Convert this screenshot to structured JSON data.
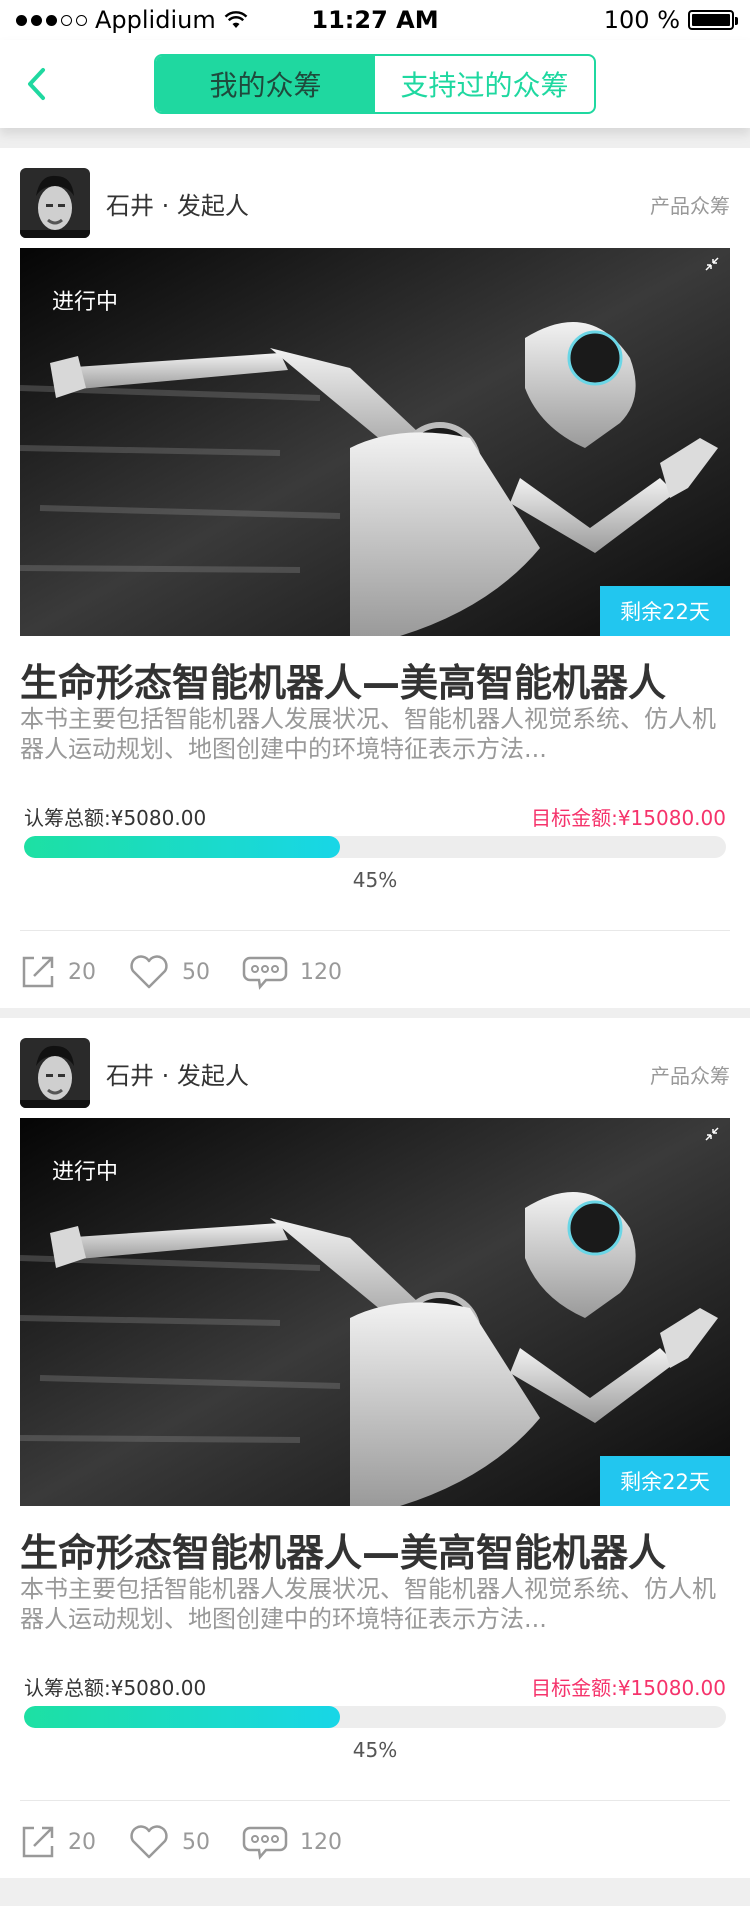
{
  "status_bar": {
    "carrier": "Applidium",
    "time": "11:27 AM",
    "battery": "100 %",
    "signal_bars_filled": 3,
    "signal_bars_total": 5
  },
  "nav": {
    "back_icon": "chevron-left-icon",
    "tabs": [
      {
        "label": "我的众筹",
        "active": true
      },
      {
        "label": "支持过的众筹",
        "active": false
      }
    ]
  },
  "projects": [
    {
      "author": "石井 · 发起人",
      "category": "产品众筹",
      "status": "进行中",
      "remaining": "剩余22天",
      "title": "生命形态智能机器人—美高智能机器人",
      "description": "本书主要包括智能机器人发展状况、智能机器人视觉系统、仿人机器人运动规划、地图创建中的环境特征表示方法...",
      "raised": "认筹总额:¥5080.00",
      "target": "目标金额:¥15080.00",
      "progress_percent": 45,
      "progress_label": "45%",
      "shares": "20",
      "likes": "50",
      "comments": "120"
    },
    {
      "author": "石井 · 发起人",
      "category": "产品众筹",
      "status": "进行中",
      "remaining": "剩余22天",
      "title": "生命形态智能机器人—美高智能机器人",
      "description": "本书主要包括智能机器人发展状况、智能机器人视觉系统、仿人机器人运动规划、地图创建中的环境特征表示方法...",
      "raised": "认筹总额:¥5080.00",
      "target": "目标金额:¥15080.00",
      "progress_percent": 45,
      "progress_label": "45%",
      "shares": "20",
      "likes": "50",
      "comments": "120"
    }
  ],
  "colors": {
    "accent": "#1fd8a0",
    "badge": "#22c6ef",
    "target": "#f5336b",
    "background": "#efefef"
  }
}
